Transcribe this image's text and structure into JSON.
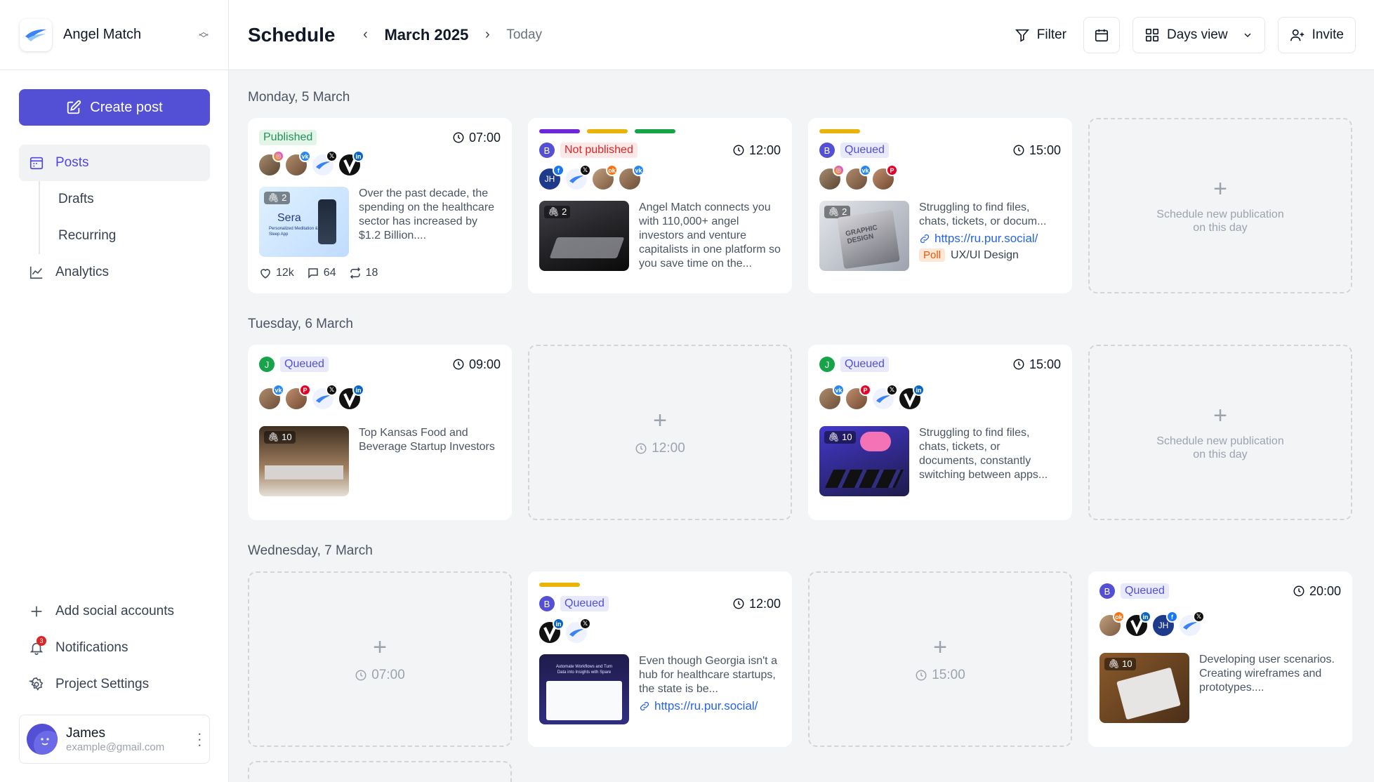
{
  "app": {
    "name": "Angel Match"
  },
  "sidebar": {
    "create_label": "Create post",
    "items": {
      "posts": "Posts",
      "drafts": "Drafts",
      "recurring": "Recurring",
      "analytics": "Analytics"
    },
    "bottom": {
      "add_social": "Add social accounts",
      "notifications": "Notifications",
      "notifications_count": "3",
      "project_settings": "Project Settings"
    },
    "user": {
      "name": "James",
      "email": "example@gmail.com"
    }
  },
  "header": {
    "title": "Schedule",
    "month": "March 2025",
    "today": "Today",
    "filter": "Filter",
    "view": "Days view",
    "invite": "Invite"
  },
  "colors": {
    "accent": "#5350d6",
    "published": "#22915a",
    "not_published": "#dc2626",
    "queued": "#5350d6",
    "link": "#2563eb"
  },
  "days": {
    "d1": "Monday, 5 March",
    "d2": "Tuesday, 6 March",
    "d3": "Wednesday, 7 March"
  },
  "empty": {
    "schedule_text": "Schedule new publication on this day",
    "t_1200": "12:00",
    "t_0700": "07:00",
    "t_1500": "15:00"
  },
  "cards": {
    "c1": {
      "status": "Published",
      "time": "07:00",
      "count": "2",
      "text": "Over the past decade, the spending on the healthcare sector has increased by $1.2 Billion....",
      "likes": "12k",
      "comments": "64",
      "reposts": "18",
      "thumb_title": "Sera",
      "thumb_sub": "Personalized Meditation & Sleep App"
    },
    "c2": {
      "letter": "B",
      "status": "Not published",
      "time": "12:00",
      "count": "2",
      "text": "Angel Match connects you with 110,000+ angel investors and venture capitalists in one platform so you save time on the..."
    },
    "c3": {
      "letter": "B",
      "status": "Queued",
      "time": "15:00",
      "count": "2",
      "text": "Struggling to find files, chats, tickets, or docum...",
      "link": "https://ru.pur.social/",
      "poll": "Poll",
      "poll_text": "UX/UI Design",
      "thumb_text": "GRAPHIC DESIGN"
    },
    "c4": {
      "letter": "J",
      "status": "Queued",
      "time": "09:00",
      "count": "10",
      "text": "Top Kansas Food and Beverage Startup Investors"
    },
    "c5": {
      "letter": "J",
      "status": "Queued",
      "time": "15:00",
      "count": "10",
      "text": "Struggling to find files, chats, tickets, or documents, constantly switching between apps..."
    },
    "c6": {
      "letter": "B",
      "status": "Queued",
      "time": "12:00",
      "text": "Even though Georgia isn't a hub for healthcare startups, the state is be...",
      "link": "https://ru.pur.social/",
      "thumb_text": "Automate Workflows and Turn Data into Insights with Spare"
    },
    "c7": {
      "letter": "B",
      "status": "Queued",
      "time": "20:00",
      "count": "10",
      "text": "Developing user scenarios. Creating wireframes and prototypes...."
    }
  },
  "avatar_initials": "JH"
}
